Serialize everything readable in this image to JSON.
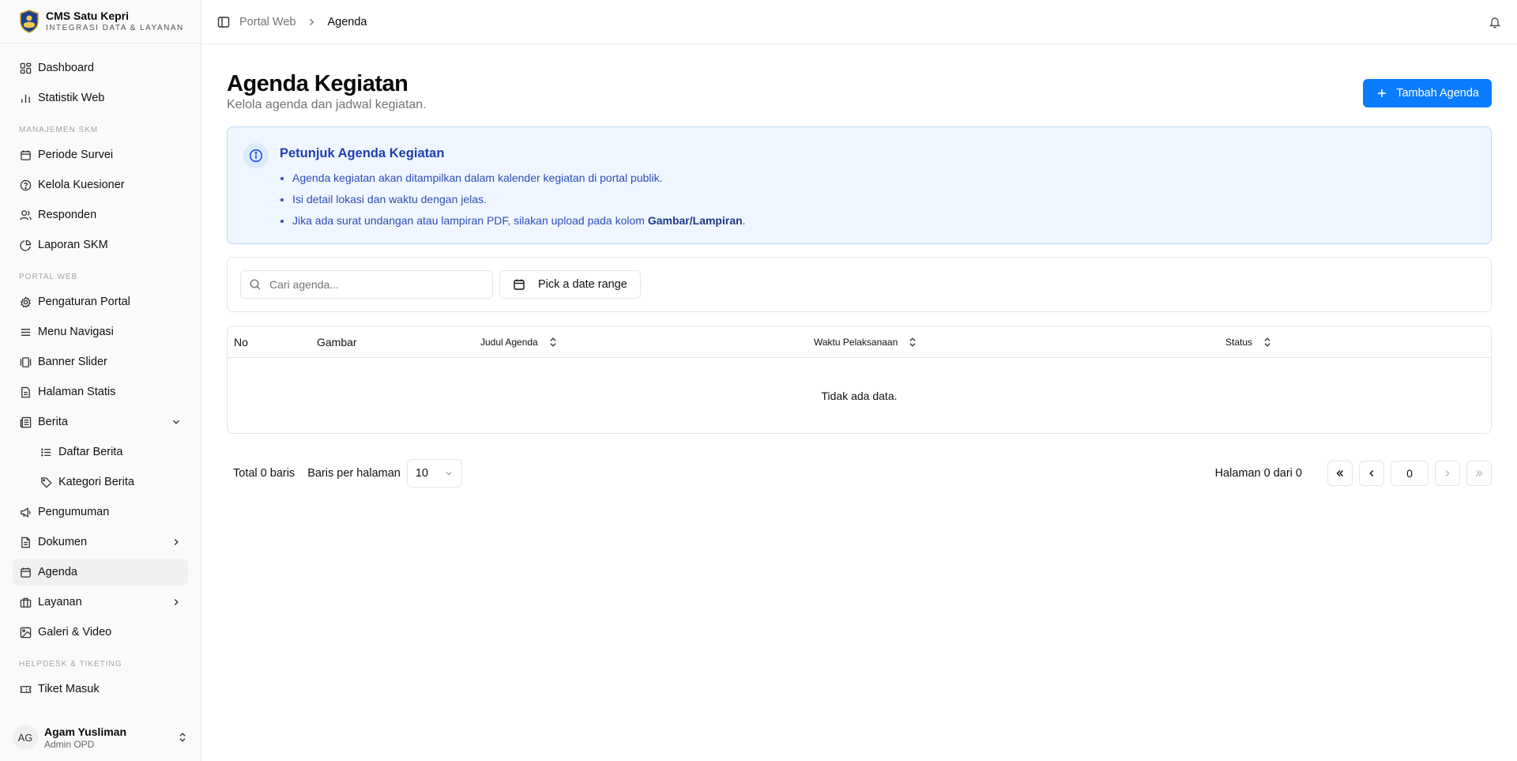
{
  "brand": {
    "title": "CMS Satu Kepri",
    "subtitle": "INTEGRASI DATA & LAYANAN"
  },
  "sidebar": {
    "items_top": [
      {
        "label": "Dashboard",
        "icon": "dashboard-icon"
      },
      {
        "label": "Statistik Web",
        "icon": "bar-chart-icon"
      }
    ],
    "section_skm": "MANAJEMEN SKM",
    "items_skm": [
      {
        "label": "Periode Survei",
        "icon": "calendar-icon"
      },
      {
        "label": "Kelola Kuesioner",
        "icon": "help-circle-icon"
      },
      {
        "label": "Responden",
        "icon": "users-icon"
      },
      {
        "label": "Laporan SKM",
        "icon": "pie-chart-icon"
      }
    ],
    "section_portal": "PORTAL WEB",
    "items_portal": [
      {
        "label": "Pengaturan Portal",
        "icon": "gear-icon"
      },
      {
        "label": "Menu Navigasi",
        "icon": "menu-icon"
      },
      {
        "label": "Banner Slider",
        "icon": "gallery-icon"
      },
      {
        "label": "Halaman Statis",
        "icon": "file-icon"
      },
      {
        "label": "Berita",
        "icon": "newspaper-icon"
      },
      {
        "label": "Daftar Berita",
        "icon": "list-icon"
      },
      {
        "label": "Kategori Berita",
        "icon": "tag-icon"
      },
      {
        "label": "Pengumuman",
        "icon": "megaphone-icon"
      },
      {
        "label": "Dokumen",
        "icon": "document-icon"
      },
      {
        "label": "Agenda",
        "icon": "calendar-icon"
      },
      {
        "label": "Layanan",
        "icon": "briefcase-icon"
      },
      {
        "label": "Galeri & Video",
        "icon": "image-icon"
      }
    ],
    "section_helpdesk": "HELPDESK & TIKETING",
    "items_helpdesk": [
      {
        "label": "Tiket Masuk",
        "icon": "ticket-icon"
      }
    ]
  },
  "user": {
    "initials": "AG",
    "name": "Agam Yusliman",
    "role": "Admin OPD"
  },
  "breadcrumb": {
    "parent": "Portal Web",
    "current": "Agenda"
  },
  "page": {
    "title": "Agenda Kegiatan",
    "subtitle": "Kelola agenda dan jadwal kegiatan.",
    "add_button": "Tambah Agenda"
  },
  "info": {
    "title": "Petunjuk Agenda Kegiatan",
    "item1": "Agenda kegiatan akan ditampilkan dalam kalender kegiatan di portal publik.",
    "item2": "Isi detail lokasi dan waktu dengan jelas.",
    "item3_pre": "Jika ada surat undangan atau lampiran PDF, silakan upload pada kolom ",
    "item3_bold": "Gambar/Lampiran",
    "item3_post": "."
  },
  "filters": {
    "search_placeholder": "Cari agenda...",
    "date_range": "Pick a date range"
  },
  "table": {
    "col_no": "No",
    "col_image": "Gambar",
    "col_title": "Judul Agenda",
    "col_time": "Waktu Pelaksanaan",
    "col_status": "Status",
    "empty": "Tidak ada data."
  },
  "pagination": {
    "total": "Total 0 baris",
    "rows_label": "Baris per halaman",
    "rows_value": "10",
    "page_info": "Halaman 0 dari 0",
    "page_input": "0"
  },
  "colors": {
    "primary": "#0a7cff",
    "info_bg": "#eff6ff",
    "info_text": "#1e40af"
  }
}
